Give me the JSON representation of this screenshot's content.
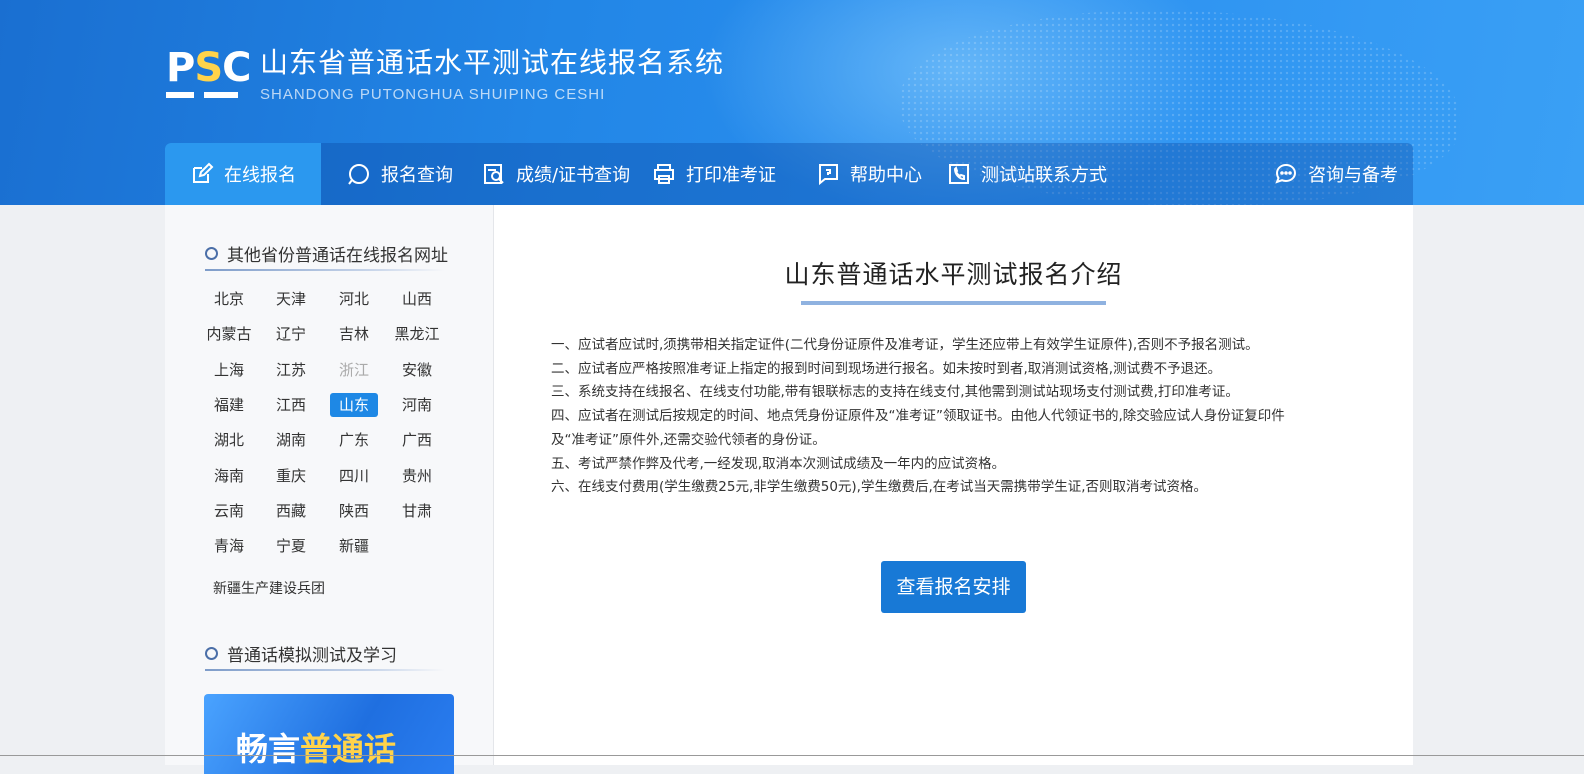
{
  "header": {
    "logo": {
      "text_before": "P",
      "text_s": "S",
      "text_after": "C"
    },
    "title": "山东省普通话水平测试在线报名系统",
    "subtitle": "SHANDONG PUTONGHUA SHUIPING CESHI"
  },
  "nav": {
    "items": [
      {
        "label": "在线报名",
        "icon": "edit-icon",
        "active": true
      },
      {
        "label": "报名查询",
        "icon": "search-icon"
      },
      {
        "label": "成绩/证书查询",
        "icon": "certificate-search-icon"
      },
      {
        "label": "打印准考证",
        "icon": "printer-icon"
      },
      {
        "label": "帮助中心",
        "icon": "help-icon"
      },
      {
        "label": "测试站联系方式",
        "icon": "phone-icon"
      },
      {
        "label": "咨询与备考",
        "icon": "chat-icon"
      }
    ]
  },
  "sidebar": {
    "provinces_title": "其他省份普通话在线报名网址",
    "provinces": [
      "北京",
      "天津",
      "河北",
      "山西",
      "内蒙古",
      "辽宁",
      "吉林",
      "黑龙江",
      "上海",
      "江苏",
      "浙江",
      "安徽",
      "福建",
      "江西",
      "山东",
      "河南",
      "湖北",
      "湖南",
      "广东",
      "广西",
      "海南",
      "重庆",
      "四川",
      "贵州",
      "云南",
      "西藏",
      "陕西",
      "甘肃",
      "青海",
      "宁夏",
      "新疆"
    ],
    "active_province": "山东",
    "dim_province": "浙江",
    "extra": "新疆生产建设兵团",
    "practice_title": "普通话模拟测试及学习",
    "banner_text_1": "畅言",
    "banner_text_2": "普通话"
  },
  "main": {
    "title": "山东普通话水平测试报名介绍",
    "rules": [
      "一、应试者应试时,须携带相关指定证件(二代身份证原件及准考证，学生还应带上有效学生证原件),否则不予报名测试。",
      "二、应试者应严格按照准考证上指定的报到时间到现场进行报名。如未按时到者,取消测试资格,测试费不予退还。",
      "三、系统支持在线报名、在线支付功能,带有银联标志的支持在线支付,其他需到测试站现场支付测试费,打印准考证。",
      "四、应试者在测试后按规定的时间、地点凭身份证原件及“准考证”领取证书。由他人代领证书的,除交验应试人身份证复印件",
      "及“准考证”原件外,还需交验代领者的身份证。",
      "五、考试严禁作弊及代考,一经发现,取消本次测试成绩及一年内的应试资格。",
      "六、在线支付费用(学生缴费25元,非学生缴费50元),学生缴费后,在考试当天需携带学生证,否则取消考试资格。"
    ],
    "button": "查看报名安排"
  },
  "colors": {
    "header_blue": "#2286e6",
    "nav_active": "#2b98ef",
    "button_blue": "#1879d6",
    "province_active": "#1e88e5",
    "logo_yellow": "#ffd34a"
  }
}
